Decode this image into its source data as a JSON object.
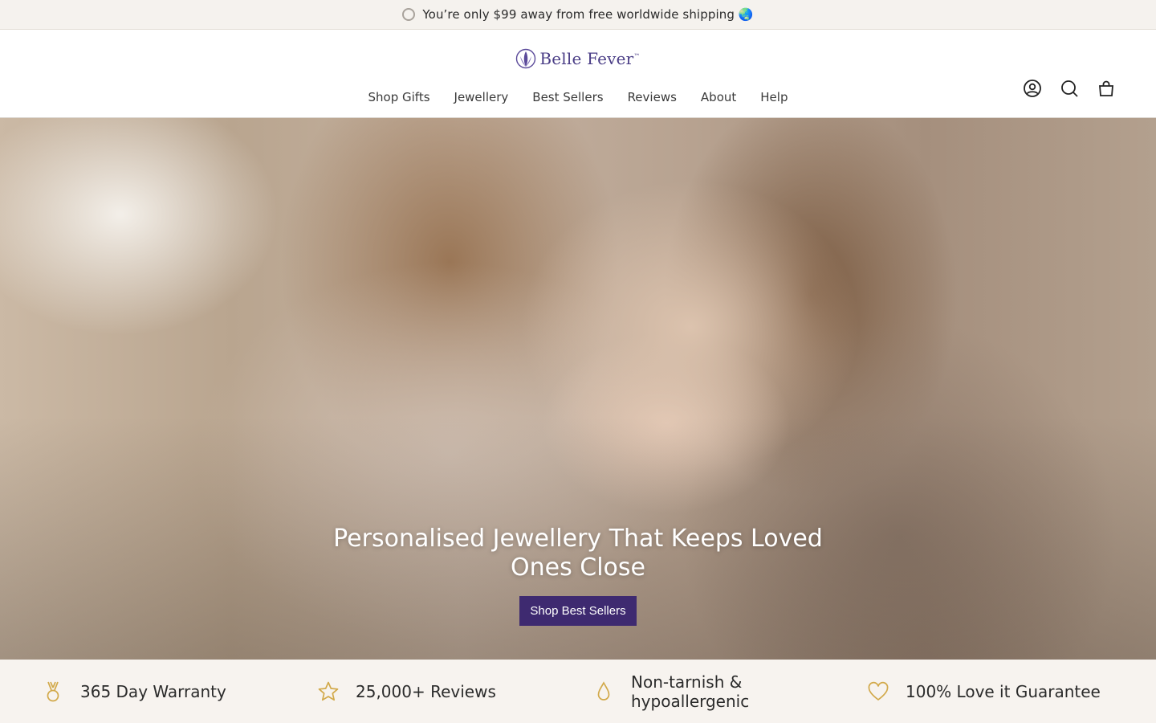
{
  "announcement": {
    "text": "You’re only $99 away from free worldwide shipping 🌏"
  },
  "logo": {
    "text": "Belle Fever",
    "trademark": "™"
  },
  "nav": [
    {
      "label": "Shop Gifts"
    },
    {
      "label": "Jewellery"
    },
    {
      "label": "Best Sellers"
    },
    {
      "label": "Reviews"
    },
    {
      "label": "About"
    },
    {
      "label": "Help"
    }
  ],
  "header_icons": [
    "account-icon",
    "search-icon",
    "cart-icon"
  ],
  "hero": {
    "title": "Personalised Jewellery That Keeps Loved Ones Close",
    "button": "Shop Best Sellers"
  },
  "usp": [
    {
      "icon": "medal-icon",
      "text": "365 Day Warranty"
    },
    {
      "icon": "star-icon",
      "text": "25,000+ Reviews"
    },
    {
      "icon": "droplet-icon",
      "text": "Non-tarnish & hypoallergenic"
    },
    {
      "icon": "heart-icon",
      "text": "100% Love it Guarantee"
    }
  ],
  "colors": {
    "brand": "#3e2a70",
    "accent_gold": "#d2a94a",
    "announcement_bg": "#f5f2ee"
  }
}
